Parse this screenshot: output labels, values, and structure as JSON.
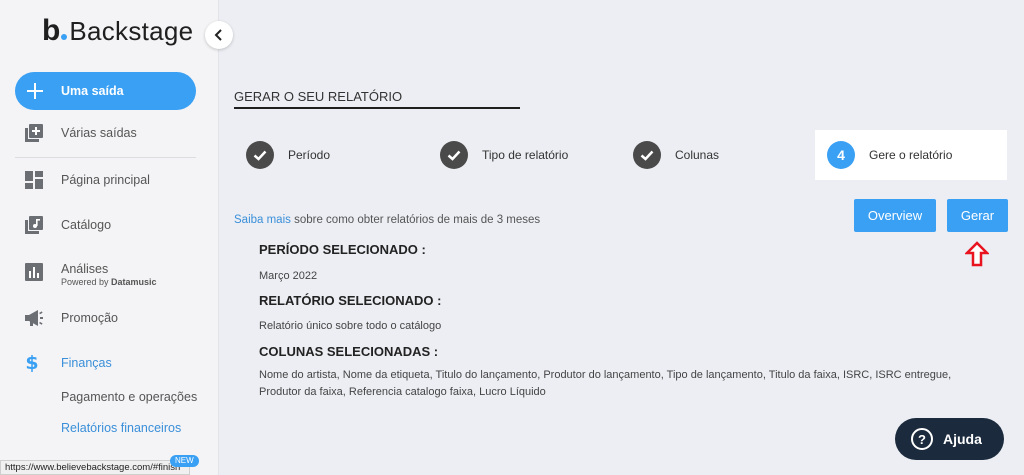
{
  "brand": {
    "logo_letter": "b",
    "name": "Backstage"
  },
  "sidebar": {
    "primary_button": "Uma saída",
    "items": [
      {
        "label": "Várias saídas",
        "icon": "library-add-icon"
      },
      {
        "label": "Página principal",
        "icon": "dashboard-icon"
      },
      {
        "label": "Catálogo",
        "icon": "music-library-icon"
      },
      {
        "label": "Análises",
        "sublabel_prefix": "Powered by",
        "sublabel_brand": "Datamusic",
        "icon": "bar-chart-icon"
      },
      {
        "label": "Promoção",
        "icon": "megaphone-icon"
      },
      {
        "label": "Finanças",
        "icon": "dollar-icon"
      }
    ],
    "sub_items": [
      "Pagamento e operações",
      "Relatórios financeiros"
    ],
    "new_badge": "NEW"
  },
  "status_bar": "https://www.believebackstage.com/#finish",
  "main": {
    "title": "GERAR O SEU RELATÓRIO",
    "steps": [
      {
        "label": "Período"
      },
      {
        "label": "Tipo de relatório"
      },
      {
        "label": "Colunas"
      },
      {
        "label": "Gere o relatório",
        "number": "4"
      }
    ],
    "info_link": "Saiba mais",
    "info_text": "sobre como obter relatórios de mais de 3 meses",
    "buttons": {
      "overview": "Overview",
      "generate": "Gerar"
    },
    "sections": [
      {
        "heading": "PERÍODO SELECIONADO :",
        "text": "Março 2022"
      },
      {
        "heading": "RELATÓRIO SELECIONADO :",
        "text": "Relatório único sobre todo o catálogo"
      },
      {
        "heading": "COLUNAS SELECIONADAS :",
        "text": "Nome do artista, Nome da etiqueta, Titulo do lançamento, Produtor do lançamento, Tipo de lançamento, Titulo da faixa, ISRC, ISRC entregue, Produtor da faixa, Referencia catalogo faixa, Lucro Líquido"
      }
    ]
  },
  "help": {
    "label": "Ajuda"
  },
  "colors": {
    "accent": "#3aa0f3",
    "dark": "#1b2a3d",
    "annotation": "#e8131f"
  }
}
